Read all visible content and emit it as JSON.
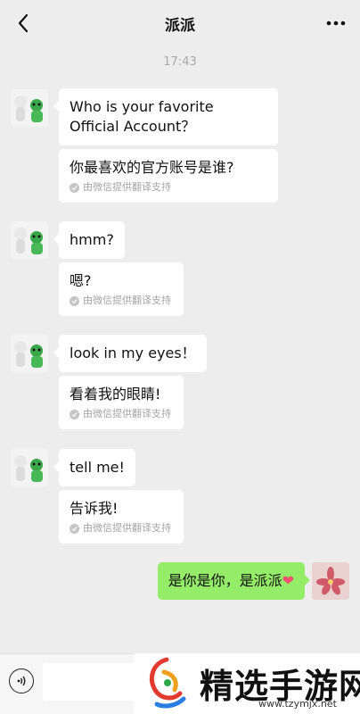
{
  "header": {
    "title": "派派"
  },
  "timestamp": "17:43",
  "colors": {
    "background": "#ededed",
    "bubble_in": "#ffffff",
    "bubble_out": "#95ec69"
  },
  "messages": [
    {
      "text": "Who is your favorite Official Account？",
      "translation": "你最喜欢的官方账号是谁?",
      "translation_note": "由微信提供翻译支持"
    },
    {
      "text": "hmm?",
      "translation": "嗯?",
      "translation_note": "由微信提供翻译支持"
    },
    {
      "text": "look in my eyes！",
      "translation": "看着我的眼睛!",
      "translation_note": "由微信提供翻译支持"
    },
    {
      "text": "tell me!",
      "translation": "告诉我!",
      "translation_note": "由微信提供翻译支持"
    }
  ],
  "reply": {
    "text": "是你是你，是派派",
    "emoji": "❤"
  },
  "watermark": {
    "text": "精选手游网",
    "url": "www.tzymjx.net"
  },
  "icons": {
    "back": "chevron-left-icon",
    "more": "more-dots-icon",
    "voice": "voice-icon",
    "check": "check-circle-icon"
  }
}
